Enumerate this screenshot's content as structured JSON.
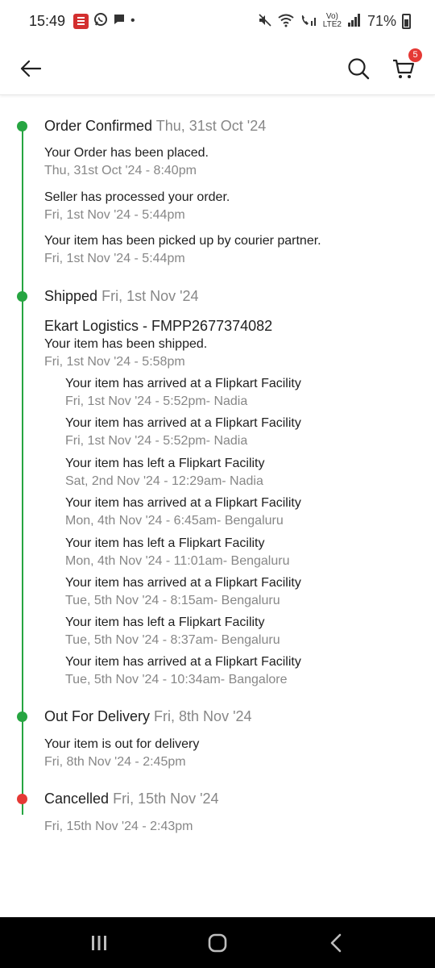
{
  "status_bar": {
    "time": "15:49",
    "left_icons": [
      "flipkart-app-icon",
      "whatsapp-icon",
      "message-icon",
      "dot"
    ],
    "right_icons": [
      "mute-icon",
      "wifi-icon",
      "call-signal-icon",
      "volte-lte2-icon",
      "signal-icon"
    ],
    "volte_label": "Vo)",
    "lte_label": "LTE2",
    "battery": "71%"
  },
  "header": {
    "back_icon": "back-arrow-icon",
    "search_icon": "search-icon",
    "cart_icon": "cart-icon",
    "cart_count": "5"
  },
  "colors": {
    "accent_green": "#26a541",
    "cancel_red": "#e53935",
    "muted_text": "#878787"
  },
  "timeline": {
    "order_confirmed": {
      "label": "Order Confirmed",
      "date": "Thu, 31st Oct '24",
      "events": [
        {
          "text": "Your Order has been placed.",
          "time": "Thu, 31st Oct '24 - 8:40pm"
        },
        {
          "text": "Seller has processed your order.",
          "time": "Fri, 1st Nov '24 - 5:44pm"
        },
        {
          "text": "Your item has been picked up by courier partner.",
          "time": "Fri, 1st Nov '24 - 5:44pm"
        }
      ]
    },
    "shipped": {
      "label": "Shipped",
      "date": "Fri, 1st Nov '24",
      "courier": "Ekart Logistics - FMPP2677374082",
      "ship_event": {
        "text": "Your item has been shipped.",
        "time": "Fri, 1st Nov '24 - 5:58pm"
      },
      "facility_events": [
        {
          "text": "Your item has arrived at a Flipkart Facility",
          "time": "Fri, 1st Nov '24 - 5:52pm- Nadia"
        },
        {
          "text": "Your item has arrived at a Flipkart Facility",
          "time": "Fri, 1st Nov '24 - 5:52pm- Nadia"
        },
        {
          "text": "Your item has left a Flipkart Facility",
          "time": "Sat, 2nd Nov '24 - 12:29am- Nadia"
        },
        {
          "text": "Your item has arrived at a Flipkart Facility",
          "time": "Mon, 4th Nov '24 - 6:45am- Bengaluru"
        },
        {
          "text": "Your item has left a Flipkart Facility",
          "time": "Mon, 4th Nov '24 - 11:01am- Bengaluru"
        },
        {
          "text": "Your item has arrived at a Flipkart Facility",
          "time": "Tue, 5th Nov '24 - 8:15am- Bengaluru"
        },
        {
          "text": "Your item has left a Flipkart Facility",
          "time": "Tue, 5th Nov '24 - 8:37am- Bengaluru"
        },
        {
          "text": "Your item has arrived at a Flipkart Facility",
          "time": "Tue, 5th Nov '24 - 10:34am- Bangalore"
        }
      ]
    },
    "out_for_delivery": {
      "label": "Out For Delivery",
      "date": "Fri, 8th Nov '24",
      "events": [
        {
          "text": "Your item is out for delivery",
          "time": "Fri, 8th Nov '24 - 2:45pm"
        }
      ]
    },
    "cancelled": {
      "label": "Cancelled",
      "date": "Fri, 15th Nov '24",
      "time": "Fri, 15th Nov '24 - 2:43pm"
    }
  },
  "nav_bar": {
    "recents_icon": "recents-icon",
    "home_icon": "home-icon",
    "back_icon": "nav-back-icon"
  }
}
